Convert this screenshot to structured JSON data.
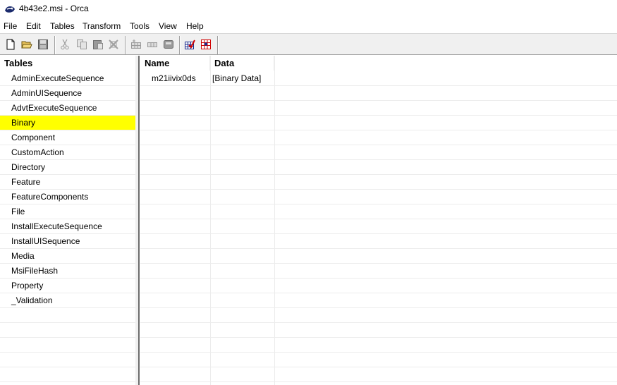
{
  "window": {
    "title": "4b43e2.msi - Orca"
  },
  "menu": [
    "File",
    "Edit",
    "Tables",
    "Transform",
    "Tools",
    "View",
    "Help"
  ],
  "toolbar_icons": [
    "new-icon",
    "open-icon",
    "save-icon",
    "cut-icon",
    "copy-icon",
    "paste-icon",
    "delete-icon",
    "add-table-icon",
    "add-row-icon",
    "drop-table-icon",
    "validate-icon",
    "transform-icon"
  ],
  "tables": {
    "header": "Tables",
    "items": [
      "AdminExecuteSequence",
      "AdminUISequence",
      "AdvtExecuteSequence",
      "Binary",
      "Component",
      "CustomAction",
      "Directory",
      "Feature",
      "FeatureComponents",
      "File",
      "InstallExecuteSequence",
      "InstallUISequence",
      "Media",
      "MsiFileHash",
      "Property",
      "_Validation"
    ],
    "selected": "Binary"
  },
  "grid": {
    "columns": [
      "Name",
      "Data"
    ],
    "rows": [
      {
        "name": "m21iivix0ds",
        "data": "[Binary Data]"
      }
    ]
  },
  "colors": {
    "selected_row": "#ffff00"
  }
}
